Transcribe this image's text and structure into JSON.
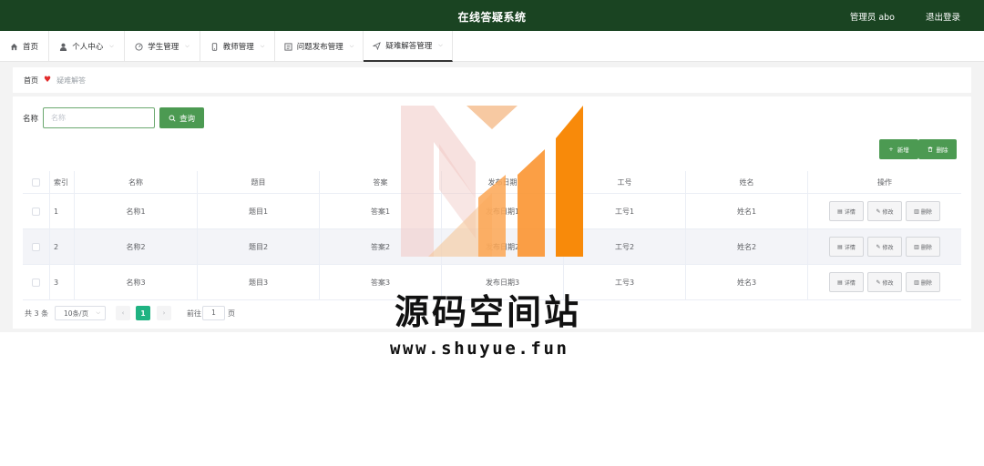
{
  "header": {
    "title": "在线答疑系统",
    "user": "管理员 abo",
    "logout": "退出登录"
  },
  "nav": {
    "items": [
      {
        "label": "首页",
        "icon": "home-icon"
      },
      {
        "label": "个人中心",
        "icon": "user-icon"
      },
      {
        "label": "学生管理",
        "icon": "gauge-icon"
      },
      {
        "label": "教师管理",
        "icon": "phone-icon"
      },
      {
        "label": "问题发布管理",
        "icon": "list-icon"
      },
      {
        "label": "疑难解答管理",
        "icon": "send-icon"
      }
    ]
  },
  "breadcrumb": {
    "home": "首页",
    "heart": "♥",
    "current": "疑难解答"
  },
  "search": {
    "label": "名称",
    "placeholder": "名称",
    "button": "查询"
  },
  "actions": {
    "add": "新增",
    "delete": "删除"
  },
  "table": {
    "columns": [
      "索引",
      "名称",
      "题目",
      "答案",
      "发布日期",
      "工号",
      "姓名",
      "操作"
    ],
    "rows": [
      [
        "1",
        "名称1",
        "题目1",
        "答案1",
        "发布日期1",
        "工号1",
        "姓名1"
      ],
      [
        "2",
        "名称2",
        "题目2",
        "答案2",
        "发布日期2",
        "工号2",
        "姓名2"
      ],
      [
        "3",
        "名称3",
        "题目3",
        "答案3",
        "发布日期3",
        "工号3",
        "姓名3"
      ]
    ],
    "row_actions": {
      "detail": "详情",
      "edit": "修改",
      "delete": "删除"
    }
  },
  "pagination": {
    "total": "共 3 条",
    "page_size": "10条/页",
    "current_page": "1",
    "goto_label": "前往",
    "goto_value": "1",
    "page_suffix": "页"
  },
  "watermark": {
    "text": "源码空间站",
    "url": "www.shuyue.fun"
  },
  "colors": {
    "header_bg": "#1a4422",
    "button_green": "#4c9a52",
    "pager_active": "#20b382",
    "heart": "#e22b2b"
  }
}
